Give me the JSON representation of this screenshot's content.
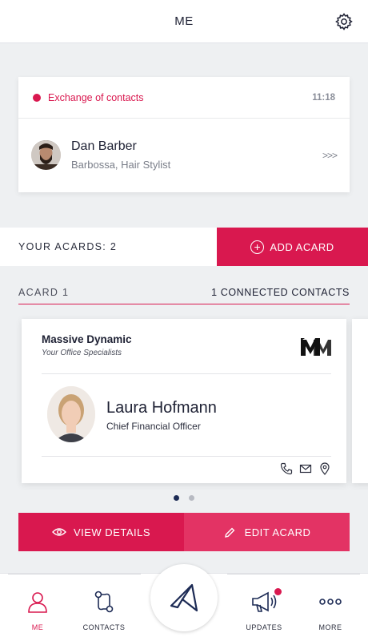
{
  "header": {
    "title": "ME"
  },
  "notification": {
    "label": "Exchange of contacts",
    "time": "11:18",
    "contact_name": "Dan Barber",
    "contact_subtitle": "Barbossa, Hair Stylist",
    "chevrons": ">>>"
  },
  "acards_bar": {
    "count_label": "YOUR ACARDS: 2",
    "add_label": "ADD ACARD"
  },
  "acard": {
    "label": "ACARD 1",
    "connected": "1 CONNECTED CONTACTS",
    "company": "Massive Dynamic",
    "tagline": "Your Office Specialists",
    "person_name": "Laura Hofmann",
    "person_title": "Chief Financial Officer"
  },
  "pager": {
    "total": 2,
    "active": 1
  },
  "actions": {
    "view_label": "VIEW DETAILS",
    "edit_label": "EDIT ACARD"
  },
  "nav": {
    "me": "ME",
    "contacts": "CONTACTS",
    "updates": "UPDATES",
    "more": "MORE"
  },
  "colors": {
    "accent": "#d9184f",
    "navy": "#1d2b55"
  }
}
